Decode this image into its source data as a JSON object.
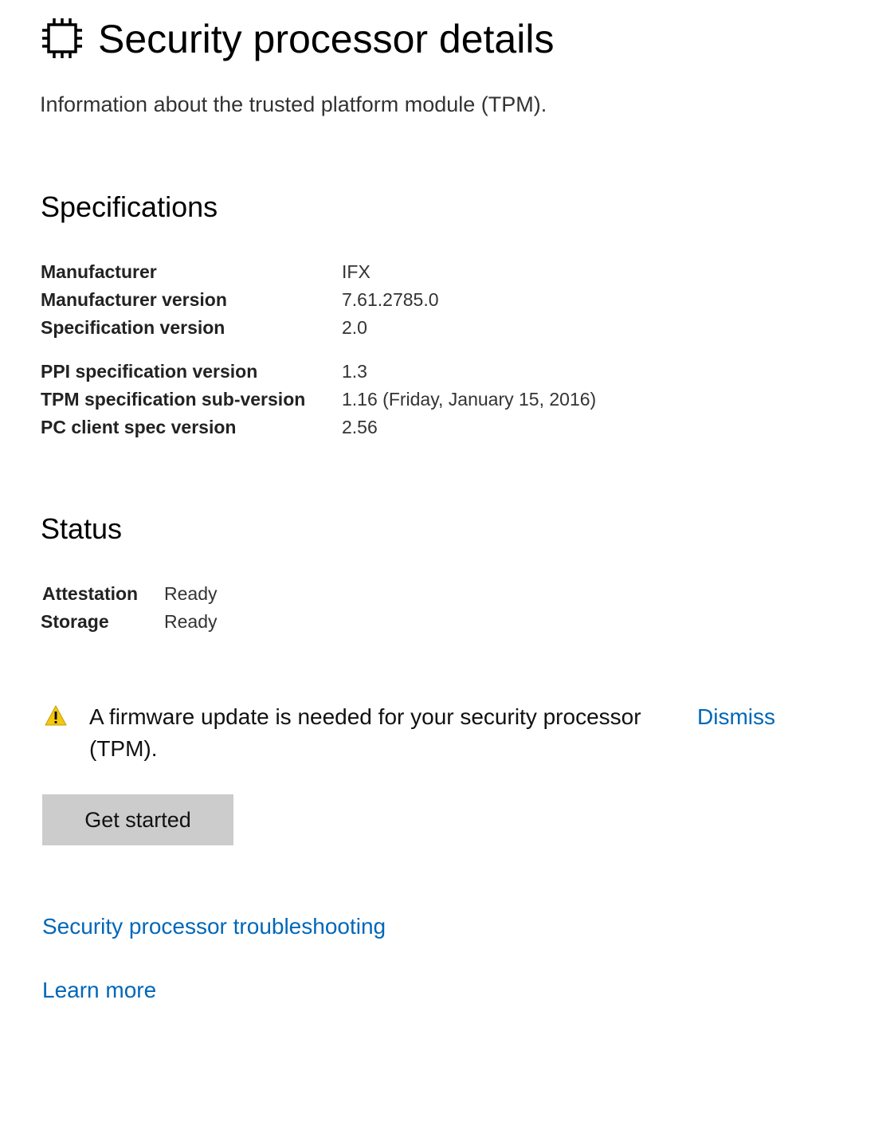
{
  "header": {
    "icon": "processor-chip-icon",
    "title": "Security processor details",
    "subtitle": "Information about the trusted platform module (TPM)."
  },
  "specifications": {
    "heading": "Specifications",
    "rows": [
      {
        "label": "Manufacturer",
        "value": "IFX"
      },
      {
        "label": "Manufacturer version",
        "value": "7.61.2785.0"
      },
      {
        "label": "Specification version",
        "value": "2.0"
      },
      {
        "label": "PPI specification version",
        "value": "1.3"
      },
      {
        "label": "TPM specification sub-version",
        "value": "1.16 (Friday, January 15, 2016)"
      },
      {
        "label": "PC client spec version",
        "value": "2.56"
      }
    ]
  },
  "status": {
    "heading": "Status",
    "rows": [
      {
        "label": "Attestation",
        "value": "Ready"
      },
      {
        "label": "Storage",
        "value": "Ready"
      }
    ]
  },
  "alert": {
    "icon": "warning-icon",
    "message": "A firmware update is needed for your security processor (TPM).",
    "dismiss_label": "Dismiss",
    "button_label": "Get started"
  },
  "links": {
    "troubleshooting": "Security processor troubleshooting",
    "learn_more": "Learn more"
  },
  "colors": {
    "link": "#0067b8",
    "button_bg": "#cccccc",
    "warning": "#f2c811"
  }
}
